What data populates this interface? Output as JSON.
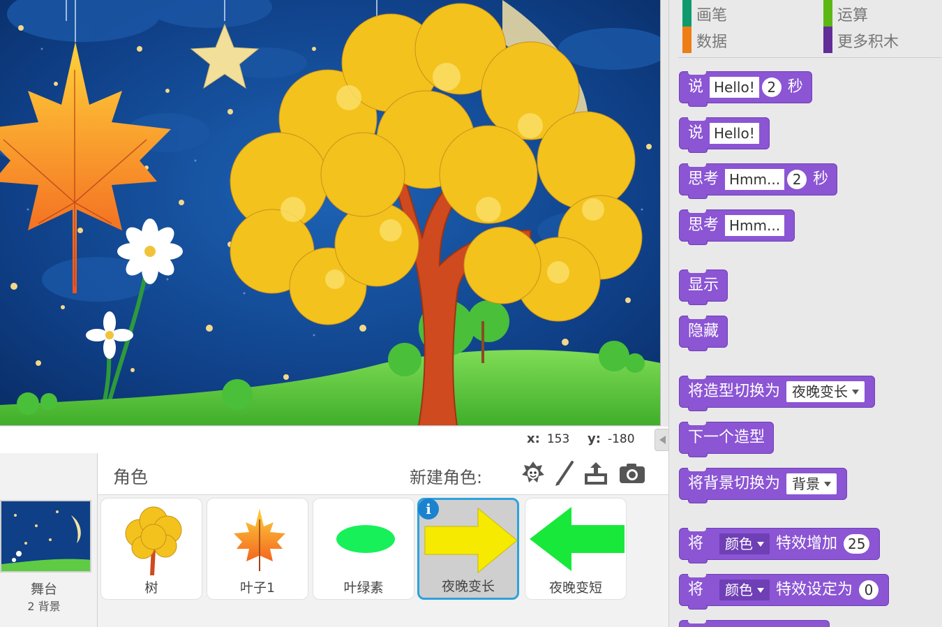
{
  "stage": {
    "coord_x_label": "x:",
    "coord_x_value": "153",
    "coord_y_label": "y:",
    "coord_y_value": "-180"
  },
  "stage_panel": {
    "label": "舞台",
    "sublabel": "2 背景"
  },
  "sprites_panel": {
    "title": "角色",
    "new_sprite_label": "新建角色:",
    "tools": [
      "sprite-library-icon",
      "paint-brush-icon",
      "upload-icon",
      "camera-icon"
    ],
    "sprites": [
      {
        "name": "树",
        "selected": false
      },
      {
        "name": "叶子1",
        "selected": false
      },
      {
        "name": "叶绿素",
        "selected": false
      },
      {
        "name": "夜晚变长",
        "selected": true
      },
      {
        "name": "夜晚变短",
        "selected": false
      }
    ],
    "info_badge": "i"
  },
  "categories": [
    {
      "name": "画笔",
      "color": "#0e9a6c"
    },
    {
      "name": "运算",
      "color": "#5cb712"
    },
    {
      "name": "数据",
      "color": "#ee7d16"
    },
    {
      "name": "更多积木",
      "color": "#632d99"
    }
  ],
  "blocks": {
    "say_secs": {
      "cmd": "说",
      "text": "Hello!",
      "secs": "2",
      "unit": "秒"
    },
    "say": {
      "cmd": "说",
      "text": "Hello!"
    },
    "think_secs": {
      "cmd": "思考",
      "text": "Hmm...",
      "secs": "2",
      "unit": "秒"
    },
    "think": {
      "cmd": "思考",
      "text": "Hmm..."
    },
    "show": {
      "cmd": "显示"
    },
    "hide": {
      "cmd": "隐藏"
    },
    "switch_costume": {
      "cmd": "将造型切换为",
      "value": "夜晚变长"
    },
    "next_costume": {
      "cmd": "下一个造型"
    },
    "switch_backdrop": {
      "cmd": "将背景切换为",
      "value": "背景"
    },
    "change_effect": {
      "cmd": "将",
      "effect": "颜色",
      "action": "特效增加",
      "value": "25"
    },
    "set_effect": {
      "cmd": "将",
      "effect": "颜色",
      "action": "特效设定为",
      "value": "0"
    }
  },
  "colors": {
    "looks_block": "#8b55d4",
    "selection": "#2ea1dd"
  }
}
